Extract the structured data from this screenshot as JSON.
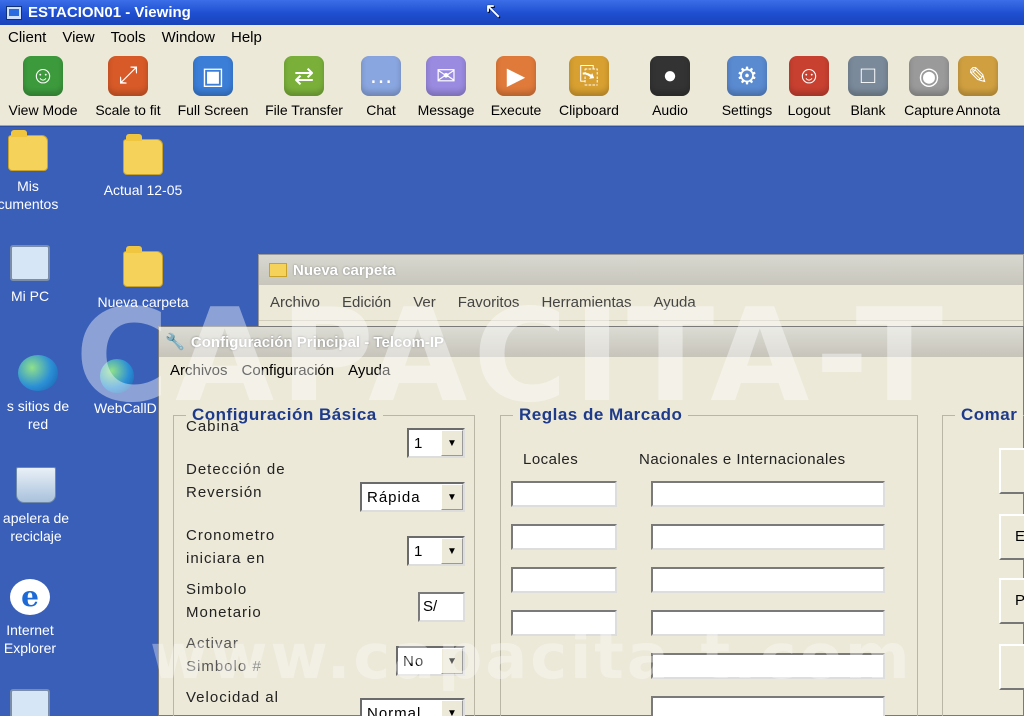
{
  "window": {
    "title": "ESTACION01 - Viewing"
  },
  "menu": [
    "Client",
    "View",
    "Tools",
    "Window",
    "Help"
  ],
  "toolbar": [
    {
      "label": "View Mode",
      "icon": "view-mode-icon",
      "color": "#3c9a3c"
    },
    {
      "label": "Scale to fit",
      "icon": "scale-icon",
      "color": "#d85a28"
    },
    {
      "label": "Full Screen",
      "icon": "fullscreen-icon",
      "color": "#3a7ed8"
    },
    {
      "label": "File Transfer",
      "icon": "file-transfer-icon",
      "color": "#7ab03a"
    },
    {
      "label": "Chat",
      "icon": "chat-icon",
      "color": "#8aa6e0"
    },
    {
      "label": "Message",
      "icon": "message-icon",
      "color": "#9a8ae0"
    },
    {
      "label": "Execute",
      "icon": "execute-icon",
      "color": "#e07a3a"
    },
    {
      "label": "Clipboard",
      "icon": "clipboard-icon",
      "color": "#d8a030"
    },
    {
      "label": "Audio",
      "icon": "microphone-icon",
      "color": "#333333"
    },
    {
      "label": "Settings",
      "icon": "gears-icon",
      "color": "#5a8ad0"
    },
    {
      "label": "Logout",
      "icon": "logout-icon",
      "color": "#c84030"
    },
    {
      "label": "Blank",
      "icon": "monitor-icon",
      "color": "#7a8a9a"
    },
    {
      "label": "Capture",
      "icon": "camera-icon",
      "color": "#9a9a9a"
    },
    {
      "label": "Annota",
      "icon": "pencils-icon",
      "color": "#d0a040"
    }
  ],
  "desktop_icons": [
    {
      "label": "Mis\ncumentos",
      "kind": "folder-icon"
    },
    {
      "label": "Actual 12-05",
      "kind": "folder-icon"
    },
    {
      "label": "Mi PC",
      "kind": "computer-icon"
    },
    {
      "label": "Nueva carpeta",
      "kind": "folder-icon"
    },
    {
      "label": "s sitios de\nred",
      "kind": "network-icon"
    },
    {
      "label": "WebCallD",
      "kind": "webcall-icon"
    },
    {
      "label": "apelera de\nreciclaje",
      "kind": "recycle-bin-icon"
    },
    {
      "label": "Internet\nExplorer",
      "kind": "ie-icon"
    }
  ],
  "explorer": {
    "title": "Nueva carpeta",
    "menu": [
      "Archivo",
      "Edición",
      "Ver",
      "Favoritos",
      "Herramientas",
      "Ayuda"
    ]
  },
  "config": {
    "title": "Configuración Principal - Telcom-IP",
    "menu": [
      "Archivos",
      "Configuración",
      "Ayuda"
    ],
    "basic": {
      "title": "Configuración Básica",
      "cabina_label": "Cabina",
      "cabina_value": "1",
      "deteccion_label": "Detección de\nReversión",
      "deteccion_value": "Rápida",
      "crono_label": "Cronometro\niniciara en",
      "crono_value": "1",
      "simbolo_label": "Simbolo\nMonetario",
      "simbolo_value": "S/",
      "activar_label": "Activar\nSimbolo #",
      "activar_value": "No",
      "velocidad_label": "Velocidad al",
      "velocidad_value": "Normal"
    },
    "reglas": {
      "title": "Reglas de Marcado",
      "locales_label": "Locales",
      "nacionales_label": "Nacionales e Internacionales"
    },
    "comandos": {
      "title": "Comar",
      "buttons": [
        "",
        "E",
        "P",
        ""
      ]
    }
  },
  "watermark": {
    "main": "CAPACITA-T",
    "url": "www.capacita-t.com"
  }
}
